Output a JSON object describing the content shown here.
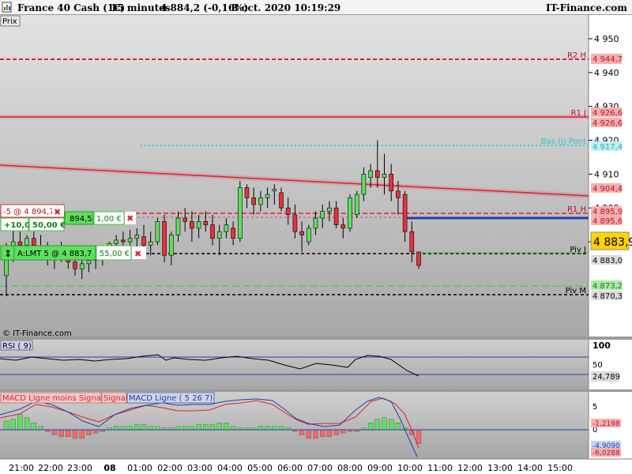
{
  "header": {
    "instrument": "France 40 Cash (1€)",
    "timeframe": "15 minutes",
    "quote": "4 884,2 (-0,16%)",
    "datetime": "8 oct. 2020 10:19:29",
    "brand": "IT-Finance.com"
  },
  "main_panel_label": "Prix",
  "watermark": "© IT-Finance.com",
  "colors": {
    "up": "#5ee05e",
    "down": "#e8313b",
    "pivot_red": "#e0202a",
    "cyan": "#3fd4d8",
    "blue": "#1f3fb0",
    "green_line": "#3cc83c"
  },
  "levels": {
    "r2h": {
      "label": "R2 H",
      "value": "4 944,7"
    },
    "r1j": {
      "label": "R1 J",
      "value": "4 926,6"
    },
    "r1j_value2": "4 926,6",
    "cyan_level": {
      "label": "Bas (J) Pont",
      "value": "4 917,4"
    },
    "trend_value": "4 904,4",
    "r1h": {
      "label": "R1 H",
      "value": "4 895,9"
    },
    "r1h_value2": "4 895,6",
    "current_price": "4 883,9",
    "pivj": {
      "label": "Piv J",
      "value": "4 883,0"
    },
    "pivm_green": "4 873,2",
    "pivm": {
      "label": "Piv M",
      "value": "4 870,3"
    }
  },
  "orders": {
    "position_label": "-5 @ 4 894,7",
    "pnl_points": "+10,0",
    "pnl_euro": "50,00 €",
    "partial_price": "894,5",
    "partial_fee": "1,00 €",
    "limit_label": "A:LMT  5 @ 4 883,7",
    "limit_value": "55,00 €",
    "close_glyph": "✖",
    "move_glyph": "↕"
  },
  "rsi": {
    "label": "RSI ( 9)",
    "value": "24,789",
    "top_tick": "100",
    "mid_tick": "50"
  },
  "macd": {
    "label1": "MACD Ligne moins Signal",
    "label2": "Signal",
    "label3": "MACD Ligne ( 5 26 7)",
    "tick_top": "5",
    "tick_mid": "0",
    "tick_bot": "-5",
    "val_signal": "-1,2198",
    "val_macd": "-4,9090",
    "val_hist": "-6,0288"
  },
  "x_labels": [
    "21:00",
    "22:00",
    "23:00",
    "08",
    "01:00",
    "02:00",
    "03:00",
    "04:00",
    "05:00",
    "06:00",
    "07:00",
    "08:00",
    "09:00",
    "10:00",
    "11:00",
    "12:00",
    "13:00",
    "14:00",
    "15:00"
  ],
  "chart_data": {
    "type": "candlestick",
    "y_ticks": [
      4950,
      4940,
      4930,
      4920,
      4910,
      4900,
      4890
    ],
    "ylim": [
      4862,
      4957
    ],
    "candles": [
      {
        "o": 4880.0,
        "h": 4889.6,
        "l": 4873.9,
        "c": 4888.1
      },
      {
        "o": 4888.1,
        "h": 4894.0,
        "l": 4884.0,
        "c": 4890.0
      },
      {
        "o": 4890.0,
        "h": 4893.0,
        "l": 4885.0,
        "c": 4889.0
      },
      {
        "o": 4889.0,
        "h": 4892.0,
        "l": 4886.0,
        "c": 4891.0
      },
      {
        "o": 4891.0,
        "h": 4893.0,
        "l": 4887.0,
        "c": 4889.0
      },
      {
        "o": 4888.8,
        "h": 4892.0,
        "l": 4885.0,
        "c": 4886.5
      },
      {
        "o": 4886.5,
        "h": 4890.0,
        "l": 4883.0,
        "c": 4885.0
      },
      {
        "o": 4885.0,
        "h": 4889.0,
        "l": 4882.0,
        "c": 4887.0
      },
      {
        "o": 4887.0,
        "h": 4890.0,
        "l": 4884.0,
        "c": 4885.5
      },
      {
        "o": 4885.5,
        "h": 4888.0,
        "l": 4882.0,
        "c": 4884.0
      },
      {
        "o": 4884.0,
        "h": 4886.0,
        "l": 4880.0,
        "c": 4882.0
      },
      {
        "o": 4882.0,
        "h": 4885.0,
        "l": 4879.0,
        "c": 4883.5
      },
      {
        "o": 4883.5,
        "h": 4886.0,
        "l": 4881.0,
        "c": 4884.5
      },
      {
        "o": 4884.5,
        "h": 4887.0,
        "l": 4882.0,
        "c": 4885.0
      },
      {
        "o": 4885.0,
        "h": 4888.0,
        "l": 4883.0,
        "c": 4887.0
      },
      {
        "o": 4887.0,
        "h": 4890.0,
        "l": 4885.0,
        "c": 4889.5
      },
      {
        "o": 4889.5,
        "h": 4892.0,
        "l": 4887.0,
        "c": 4890.5
      },
      {
        "o": 4890.5,
        "h": 4893.0,
        "l": 4888.0,
        "c": 4890.0
      },
      {
        "o": 4890.0,
        "h": 4893.5,
        "l": 4887.0,
        "c": 4891.0
      },
      {
        "o": 4891.0,
        "h": 4894.0,
        "l": 4888.0,
        "c": 4892.0
      },
      {
        "o": 4891.5,
        "h": 4895.0,
        "l": 4888.0,
        "c": 4889.0
      },
      {
        "o": 4889.0,
        "h": 4893.0,
        "l": 4886.0,
        "c": 4890.0
      },
      {
        "o": 4890.0,
        "h": 4897.0,
        "l": 4889.0,
        "c": 4896.0
      },
      {
        "o": 4896.0,
        "h": 4898.0,
        "l": 4884.0,
        "c": 4886.0
      },
      {
        "o": 4886.0,
        "h": 4893.0,
        "l": 4883.0,
        "c": 4892.0
      },
      {
        "o": 4892.0,
        "h": 4899.0,
        "l": 4890.0,
        "c": 4897.0
      },
      {
        "o": 4897.0,
        "h": 4900.0,
        "l": 4893.0,
        "c": 4896.0
      },
      {
        "o": 4896.0,
        "h": 4899.0,
        "l": 4890.0,
        "c": 4894.0
      },
      {
        "o": 4894.0,
        "h": 4898.0,
        "l": 4891.0,
        "c": 4896.0
      },
      {
        "o": 4896.0,
        "h": 4899.0,
        "l": 4893.0,
        "c": 4895.0
      },
      {
        "o": 4895.0,
        "h": 4898.0,
        "l": 4889.0,
        "c": 4891.0
      },
      {
        "o": 4891.0,
        "h": 4895.0,
        "l": 4886.0,
        "c": 4893.0
      },
      {
        "o": 4893.0,
        "h": 4897.0,
        "l": 4891.0,
        "c": 4895.0
      },
      {
        "o": 4894.0,
        "h": 4896.0,
        "l": 4889.0,
        "c": 4891.0
      },
      {
        "o": 4891.0,
        "h": 4908.0,
        "l": 4890.0,
        "c": 4906.0
      },
      {
        "o": 4906.0,
        "h": 4907.0,
        "l": 4900.0,
        "c": 4903.0
      },
      {
        "o": 4903.0,
        "h": 4906.0,
        "l": 4898.0,
        "c": 4901.0
      },
      {
        "o": 4901.0,
        "h": 4905.0,
        "l": 4899.0,
        "c": 4903.0
      },
      {
        "o": 4903.0,
        "h": 4906.0,
        "l": 4900.0,
        "c": 4904.0
      },
      {
        "o": 4905.0,
        "h": 4907.0,
        "l": 4901.0,
        "c": 4905.5
      },
      {
        "o": 4904.5,
        "h": 4906.0,
        "l": 4899.0,
        "c": 4900.0
      },
      {
        "o": 4900.0,
        "h": 4903.0,
        "l": 4895.0,
        "c": 4898.0
      },
      {
        "o": 4898.0,
        "h": 4901.0,
        "l": 4891.0,
        "c": 4893.0
      },
      {
        "o": 4893.0,
        "h": 4896.0,
        "l": 4887.0,
        "c": 4892.0
      },
      {
        "o": 4890.0,
        "h": 4895.0,
        "l": 4889.0,
        "c": 4894.0
      },
      {
        "o": 4894.0,
        "h": 4899.0,
        "l": 4892.0,
        "c": 4897.0
      },
      {
        "o": 4897.0,
        "h": 4901.0,
        "l": 4894.0,
        "c": 4899.0
      },
      {
        "o": 4899.0,
        "h": 4902.0,
        "l": 4896.0,
        "c": 4900.0
      },
      {
        "o": 4900.0,
        "h": 4902.0,
        "l": 4894.0,
        "c": 4895.0
      },
      {
        "o": 4895.0,
        "h": 4897.0,
        "l": 4891.0,
        "c": 4894.0
      },
      {
        "o": 4894.0,
        "h": 4904.0,
        "l": 4893.0,
        "c": 4903.0
      },
      {
        "o": 4898.0,
        "h": 4905.0,
        "l": 4897.0,
        "c": 4904.0
      },
      {
        "o": 4904.0,
        "h": 4912.0,
        "l": 4902.0,
        "c": 4910.0
      },
      {
        "o": 4909.0,
        "h": 4913.0,
        "l": 4906.0,
        "c": 4911.0
      },
      {
        "o": 4911.0,
        "h": 4920.0,
        "l": 4906.0,
        "c": 4909.0
      },
      {
        "o": 4909.0,
        "h": 4916.0,
        "l": 4904.0,
        "c": 4910.0
      },
      {
        "o": 4910.0,
        "h": 4913.0,
        "l": 4902.0,
        "c": 4905.0
      },
      {
        "o": 4905.0,
        "h": 4908.0,
        "l": 4898.0,
        "c": 4903.0
      },
      {
        "o": 4904.0,
        "h": 4905.0,
        "l": 4890.0,
        "c": 4893.0
      },
      {
        "o": 4893.0,
        "h": 4896.0,
        "l": 4884.0,
        "c": 4887.0
      },
      {
        "o": 4887.0,
        "h": 4887.0,
        "l": 4882.0,
        "c": 4883.0
      }
    ]
  }
}
